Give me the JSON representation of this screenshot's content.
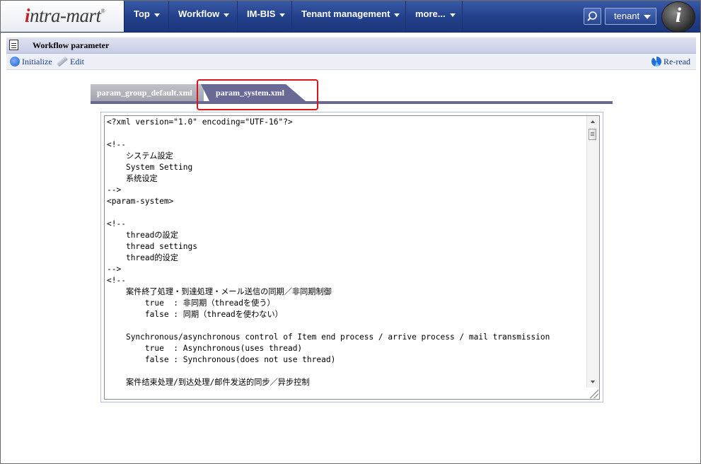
{
  "header": {
    "logo_text": "intra-mart",
    "menu": [
      {
        "label": "Top"
      },
      {
        "label": "Workflow"
      },
      {
        "label": "IM-BIS"
      },
      {
        "label": "Tenant management"
      },
      {
        "label": "more..."
      }
    ],
    "tenant_label": "tenant"
  },
  "page": {
    "title": "Workflow parameter"
  },
  "toolbar": {
    "initialize_label": "Initialize",
    "edit_label": "Edit",
    "reread_label": "Re-read"
  },
  "tabs": [
    {
      "label": "param_group_default.xml",
      "active": false
    },
    {
      "label": "param_system.xml",
      "active": true
    }
  ],
  "editor": {
    "content": "<?xml version=\"1.0\" encoding=\"UTF-16\"?>\n\n<!--\n    システム設定\n    System Setting\n    系统设定\n-->\n<param-system>\n\n<!--\n    threadの設定\n    thread settings\n    thread的设定\n-->\n<!--\n    案件終了処理・到達処理・メール送信の同期／非同期制御\n        true  : 非同期（threadを使う）\n        false : 同期（threadを使わない）\n\n    Synchronous/asynchronous control of Item end process / arrive process / mail transmission\n        true  : Asynchronous(uses thread)\n        false : Synchronous(does not use thread)\n\n    案件结束处理/到达处理/邮件发送的同步／异步控制"
  },
  "colors": {
    "nav_bg": "#23418c",
    "tab_active": "#6a6996",
    "highlight": "#d8141c",
    "link": "#17398f"
  }
}
